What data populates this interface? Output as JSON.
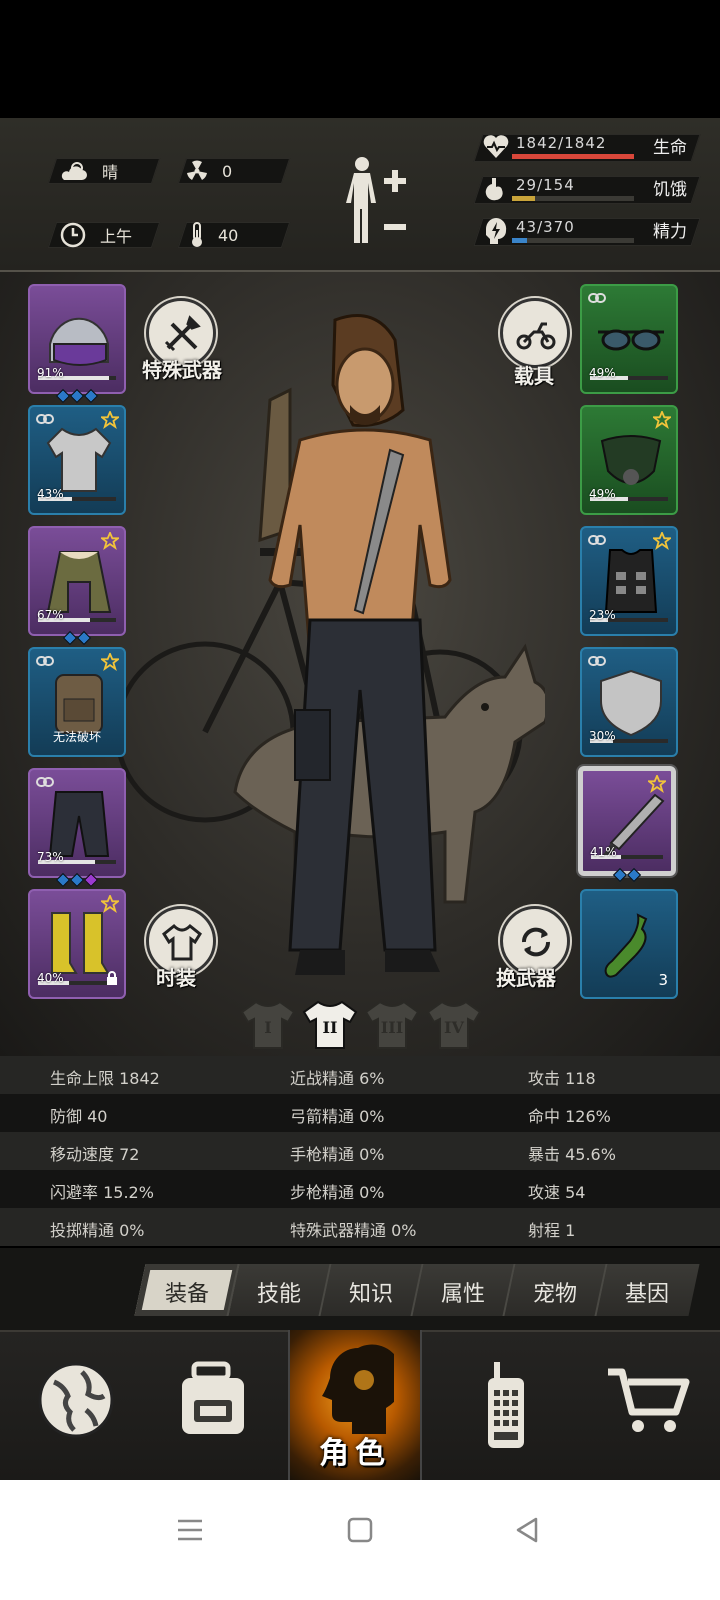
{
  "hud": {
    "weather": "晴",
    "radiation": "0",
    "time_of_day": "上午",
    "temperature": "40",
    "health": {
      "value": "1842/1842",
      "label": "生命",
      "fill": 1.0,
      "color": "#d9473a"
    },
    "hunger": {
      "value": "29/154",
      "label": "饥饿",
      "fill": 0.19,
      "color": "#c9a43a"
    },
    "energy": {
      "value": "43/370",
      "label": "精力",
      "fill": 0.12,
      "color": "#3a84c9"
    }
  },
  "buttons": {
    "special_weapon": "特殊武器",
    "vehicle": "载具",
    "outfit": "时装",
    "swap_weapon": "换武器"
  },
  "left_slots": [
    {
      "pct": "91%",
      "fill": 0.91,
      "rarity": "purple",
      "gems": [
        "#2a79c8",
        "#2a79c8",
        "#2a79c8"
      ],
      "star": false,
      "link": false
    },
    {
      "pct": "43%",
      "fill": 0.43,
      "rarity": "blue",
      "gems": [],
      "star": true,
      "link": true
    },
    {
      "pct": "67%",
      "fill": 0.67,
      "rarity": "purple",
      "gems": [
        "#2a79c8",
        "#2a79c8"
      ],
      "star": true,
      "link": false
    },
    {
      "text": "无法破坏",
      "rarity": "blue",
      "gems": [],
      "star": true,
      "link": true
    },
    {
      "pct": "73%",
      "fill": 0.73,
      "rarity": "purple",
      "gems": [
        "#2a79c8",
        "#2a79c8",
        "#9b3ad0"
      ],
      "star": false,
      "link": true
    },
    {
      "pct": "40%",
      "fill": 0.4,
      "rarity": "purple",
      "gems": [],
      "star": true,
      "link": false,
      "lock": true
    }
  ],
  "right_slots": [
    {
      "pct": "49%",
      "fill": 0.49,
      "rarity": "green",
      "gems": [],
      "star": false,
      "link": true
    },
    {
      "pct": "49%",
      "fill": 0.49,
      "rarity": "green",
      "gems": [],
      "star": true,
      "link": false
    },
    {
      "pct": "23%",
      "fill": 0.23,
      "rarity": "blue",
      "gems": [],
      "star": true,
      "link": true
    },
    {
      "pct": "30%",
      "fill": 0.3,
      "rarity": "blue",
      "gems": [],
      "star": false,
      "link": true
    },
    {
      "pct": "41%",
      "fill": 0.41,
      "rarity": "purple",
      "gems": [
        "#2a79c8",
        "#2a79c8"
      ],
      "star": true,
      "link": false,
      "selected": true
    },
    {
      "count": "3",
      "rarity": "blue",
      "gems": [],
      "star": false,
      "link": false
    }
  ],
  "outfit_tabs": [
    "I",
    "II",
    "III",
    "IV"
  ],
  "attributes": [
    [
      "生命上限 1842",
      "近战精通 6%",
      "攻击 118"
    ],
    [
      "防御 40",
      "弓箭精通 0%",
      "命中 126%"
    ],
    [
      "移动速度 72",
      "手枪精通 0%",
      "暴击 45.6%"
    ],
    [
      "闪避率 15.2%",
      "步枪精通 0%",
      "攻速 54"
    ],
    [
      "投掷精通 0%",
      "特殊武器精通 0%",
      "射程 1"
    ]
  ],
  "tabs": [
    "装备",
    "技能",
    "知识",
    "属性",
    "宠物",
    "基因"
  ],
  "nav": {
    "character": "角色"
  }
}
